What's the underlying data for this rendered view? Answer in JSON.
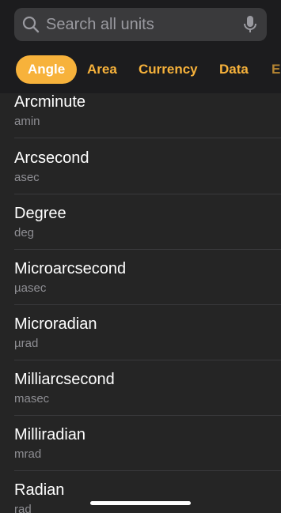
{
  "search": {
    "placeholder": "Search all units",
    "icon": "search-icon",
    "mic_icon": "microphone-icon"
  },
  "tabs": [
    {
      "label": "Angle",
      "active": true
    },
    {
      "label": "Area",
      "active": false
    },
    {
      "label": "Currency",
      "active": false
    },
    {
      "label": "Data",
      "active": false
    },
    {
      "label": "E",
      "active": false
    }
  ],
  "units": [
    {
      "name": "Arcminute",
      "abbr": "amin"
    },
    {
      "name": "Arcsecond",
      "abbr": "asec"
    },
    {
      "name": "Degree",
      "abbr": "deg"
    },
    {
      "name": "Microarcsecond",
      "abbr": "µasec"
    },
    {
      "name": "Microradian",
      "abbr": "µrad"
    },
    {
      "name": "Milliarcsecond",
      "abbr": "masec"
    },
    {
      "name": "Milliradian",
      "abbr": "mrad"
    },
    {
      "name": "Radian",
      "abbr": "rad"
    }
  ],
  "colors": {
    "accent": "#f7b23b",
    "background": "#252525",
    "header": "#1c1c1e"
  }
}
